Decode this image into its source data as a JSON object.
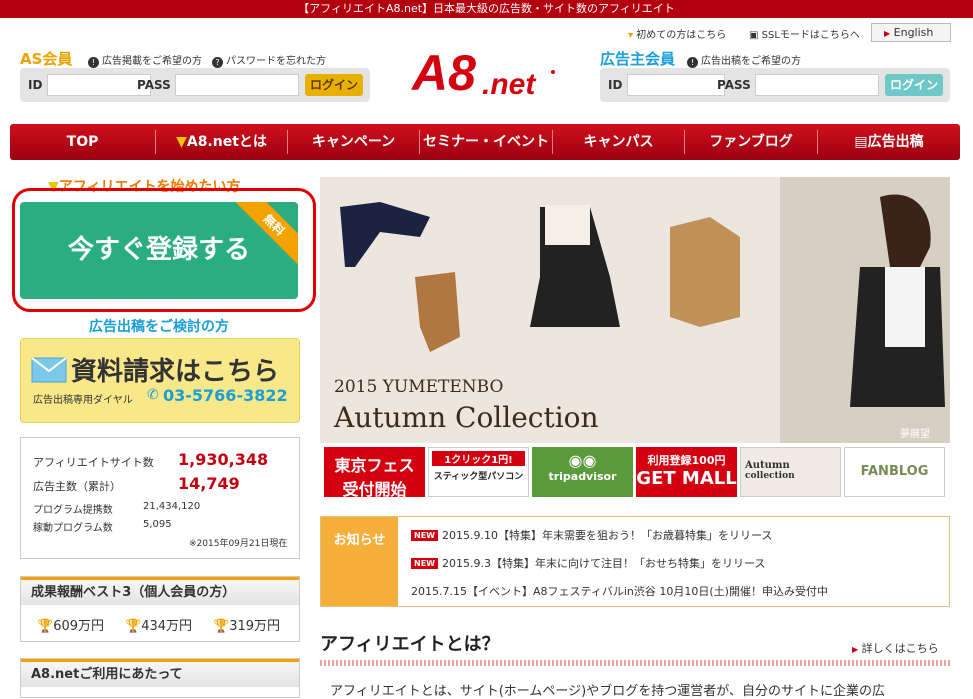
{
  "topbar": {
    "text": "【アフィリエイトA8.net】日本最大級の広告数・サイト数のアフィリエイト"
  },
  "header_links": {
    "first_time": "初めての方はこちら",
    "ssl": "SSLモードはこちらへ",
    "english": "English"
  },
  "as_member": {
    "title": "AS会員",
    "link_ad": "広告掲載をご希望の方",
    "link_pw": "パスワードを忘れた方",
    "id_label": "ID",
    "pass_label": "PASS",
    "login": "ログイン"
  },
  "advertiser": {
    "title": "広告主会員",
    "link": "広告出稿をご希望の方",
    "id_label": "ID",
    "pass_label": "PASS",
    "login": "ログイン"
  },
  "logo": {
    "text": "A8.net"
  },
  "nav": [
    "TOP",
    "A8.netとは",
    "キャンペーン",
    "セミナー・イベント",
    "キャンパス",
    "ファンブログ",
    "広告出稿"
  ],
  "left": {
    "start_caption": "アフィリエイトを始めたい方",
    "register": "今すぐ登録する",
    "free_badge": "無料",
    "consider_caption": "広告出稿をご検討の方",
    "doc_title": "資料請求はこちら",
    "doc_sub": "広告出稿専用ダイヤル",
    "doc_phone": "03-5766-3822"
  },
  "stats": {
    "sites_label": "アフィリエイトサイト数",
    "sites_value": "1,930,348",
    "ads_label": "広告主数（累計）",
    "ads_value": "14,749",
    "programs_label": "プログラム提携数",
    "programs_value": "21,434,120",
    "active_label": "稼動プログラム数",
    "active_value": "5,095",
    "as_of": "※2015年09月21日現在"
  },
  "best3": {
    "title": "成果報酬ベスト3（個人会員の方）",
    "items": [
      "609万円",
      "434万円",
      "319万円"
    ]
  },
  "usage": {
    "title": "A8.netご利用にあたって"
  },
  "banner": {
    "line1": "2015 YUMETENBO",
    "line2": "Autumn Collection",
    "brand": "夢展望"
  },
  "thumbs": [
    {
      "l1": "東京フェス",
      "l2": "受付開始"
    },
    {
      "l1": "1クリック1円!",
      "l2": "スティック型パソコン"
    },
    {
      "l1": "tripadvisor",
      "l2": ""
    },
    {
      "l1": "利用登録100円",
      "l2": "GET MALL"
    },
    {
      "l1": "Autumn",
      "l2": "collection"
    },
    {
      "l1": "FANBLOG",
      "l2": ""
    }
  ],
  "news": {
    "label": "お知らせ",
    "new_tag": "NEW",
    "items": [
      "2015.9.10【特集】年末需要を狙おう！「お歳暮特集」をリリース",
      "2015.9.3【特集】年末に向けて注目！「おせち特集」をリリース",
      "2015.7.15【イベント】A8フェスティバルin渋谷 10月10日(土)開催！申込み受付中"
    ]
  },
  "about": {
    "title": "アフィリエイトとは？",
    "more": "詳しくはこちら",
    "text": "アフィリエイトとは、サイト(ホームページ)やブログを持つ運営者が、自分のサイトに企業の広"
  },
  "colors": {
    "brand_red": "#b3000f",
    "register_green": "#2aad80",
    "accent_orange": "#f3a200"
  }
}
